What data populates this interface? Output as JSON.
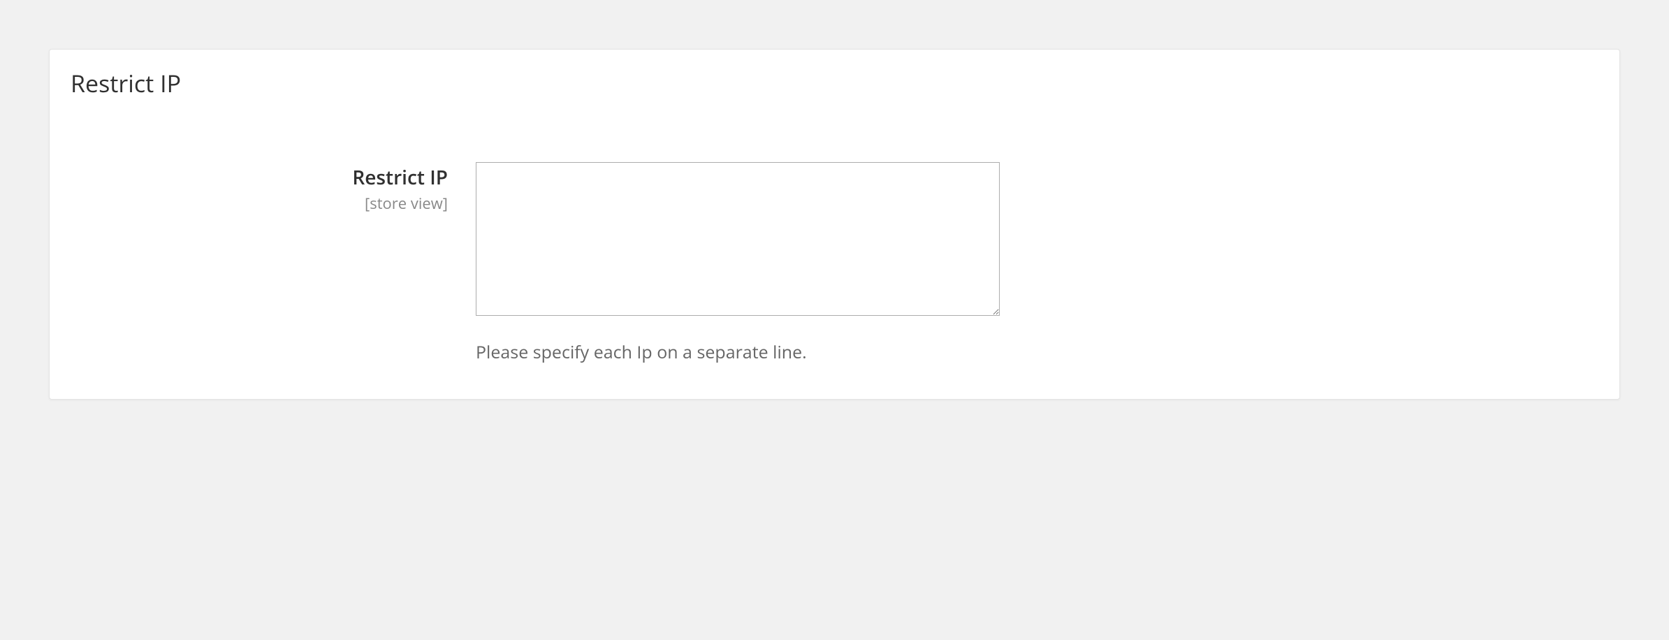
{
  "panel": {
    "title": "Restrict IP",
    "field": {
      "label": "Restrict IP",
      "scope": "[store view]",
      "value": "",
      "note": "Please specify each Ip on a separate line."
    }
  }
}
